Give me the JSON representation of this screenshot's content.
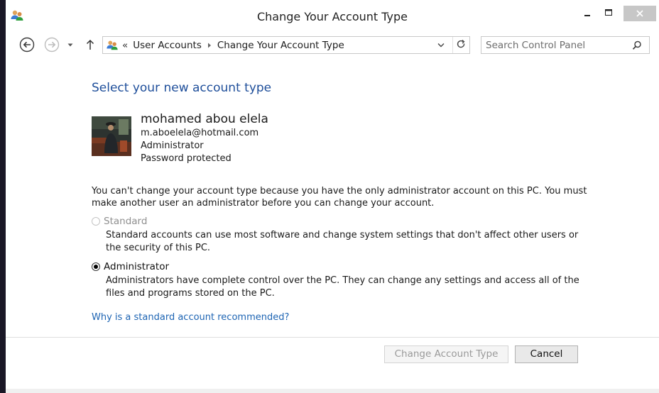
{
  "window": {
    "title": "Change Your Account Type"
  },
  "nav": {
    "breadcrumbs": [
      {
        "label": "User Accounts"
      },
      {
        "label": "Change Your Account Type"
      }
    ],
    "overflow_marker": "«",
    "search_placeholder": "Search Control Panel"
  },
  "page": {
    "heading": "Select your new account type",
    "user": {
      "name": "mohamed abou elela",
      "email": "m.aboelela@hotmail.com",
      "type": "Administrator",
      "status": "Password protected"
    },
    "notice": "You can't change your account type because you have the only administrator account on this PC. You must make another user an administrator before you can change your account.",
    "options": [
      {
        "label": "Standard",
        "description": "Standard accounts can use most software and change system settings that don't affect other users or the security of this PC.",
        "selected": false,
        "enabled": false
      },
      {
        "label": "Administrator",
        "description": "Administrators have complete control over the PC. They can change any settings and access all of the files and programs stored on the PC.",
        "selected": true,
        "enabled": true
      }
    ],
    "help_link": "Why is a standard account recommended?"
  },
  "buttons": {
    "change_label": "Change Account Type",
    "cancel_label": "Cancel"
  },
  "colors": {
    "accent": "#1e4e9a",
    "link": "#1d64b3",
    "desktop": "#1a1726"
  }
}
